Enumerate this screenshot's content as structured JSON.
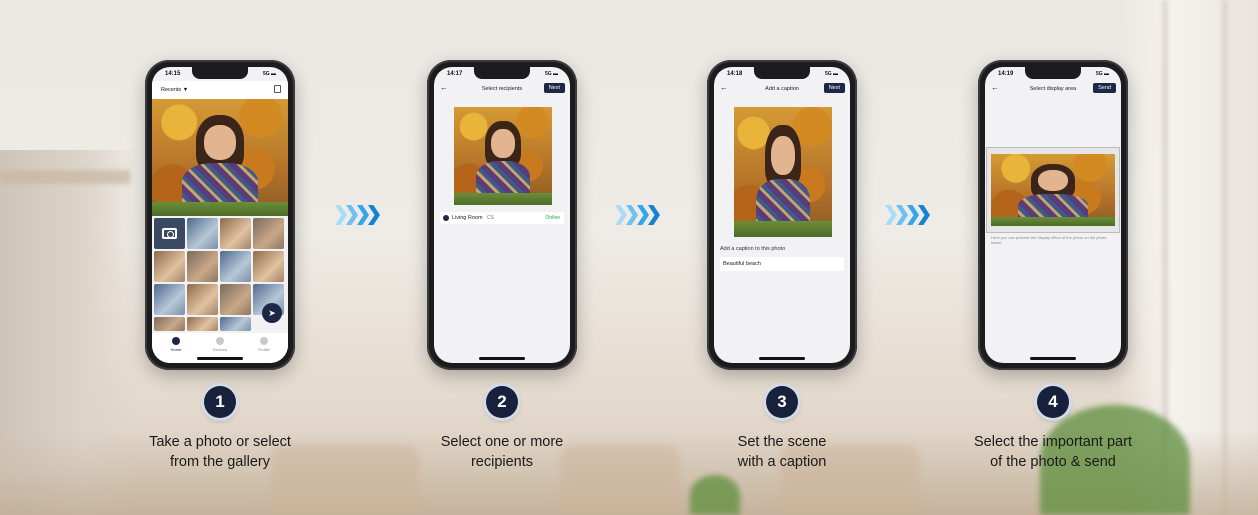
{
  "steps": [
    {
      "number": "1",
      "caption_line1": "Take a photo or select",
      "caption_line2": "from the gallery",
      "phone": {
        "time": "14:15",
        "dropdown": "Recents ▼",
        "tabs": [
          "Home",
          "Devices",
          "Profile"
        ]
      }
    },
    {
      "number": "2",
      "caption_line1": "Select one or more",
      "caption_line2": "recipients",
      "phone": {
        "time": "14:17",
        "title": "Select recipients",
        "action": "Next",
        "recipient_name": "Living Room",
        "recipient_code": "CS",
        "recipient_status": "Online"
      }
    },
    {
      "number": "3",
      "caption_line1": "Set the scene",
      "caption_line2": "with a caption",
      "phone": {
        "time": "14:18",
        "title": "Add a caption",
        "action": "Next",
        "caption_label": "Add a caption to this photo",
        "caption_value": "Beautiful beach"
      }
    },
    {
      "number": "4",
      "caption_line1": "Select the important part",
      "caption_line2": "of the photo & send",
      "phone": {
        "time": "14:19",
        "title": "Select display area",
        "action": "Send",
        "hint": "Here you can preview the display effect of the photo on the photo frame"
      }
    }
  ],
  "status_signal": "5G ▬",
  "colors": {
    "navy": "#17213b",
    "arrow_blue": "#2aa0e6",
    "online_green": "#2aa24a"
  },
  "icons": [
    "camera-icon",
    "send-icon",
    "back-arrow-icon",
    "chevron-arrows-icon"
  ]
}
